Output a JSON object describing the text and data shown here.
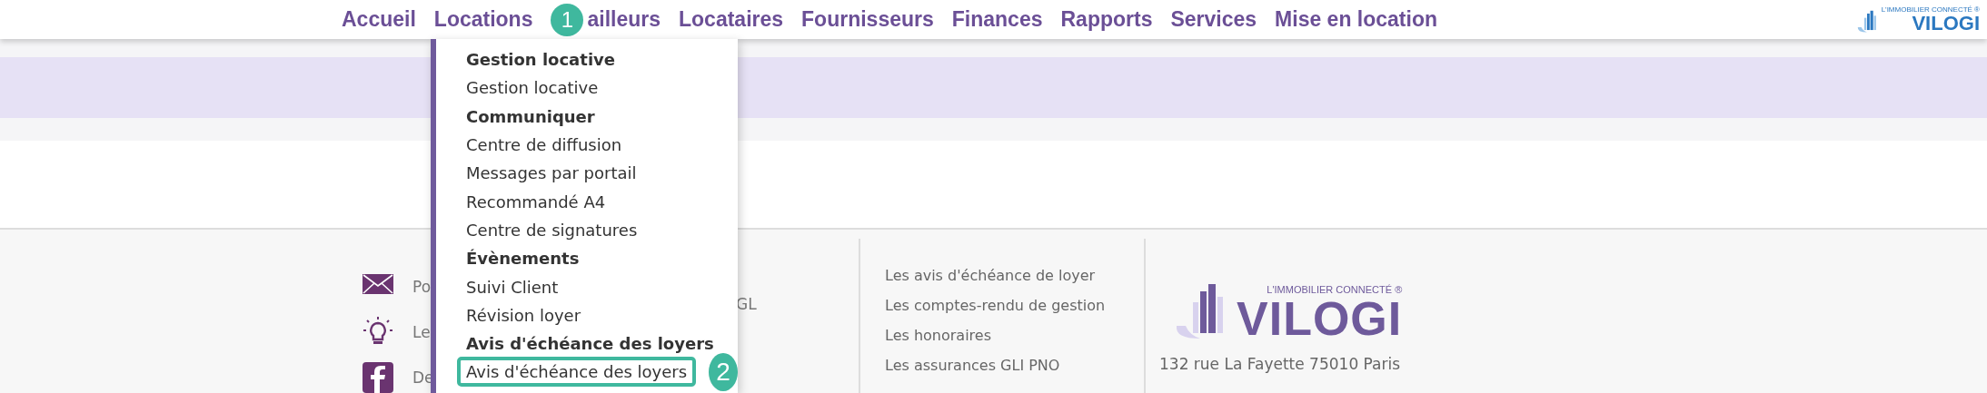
{
  "nav": {
    "items": [
      {
        "label": "Accueil"
      },
      {
        "label": "Locations"
      },
      {
        "label": "ailleurs",
        "callout": "1"
      },
      {
        "label": "Locataires"
      },
      {
        "label": "Fournisseurs"
      },
      {
        "label": "Finances"
      },
      {
        "label": "Rapports"
      },
      {
        "label": "Services"
      },
      {
        "label": "Mise en location"
      }
    ],
    "logo": {
      "tagline": "L'IMMOBILIER CONNECTÉ ®",
      "name": "VILOGI"
    }
  },
  "dropdown": {
    "items": [
      {
        "kind": "heading",
        "label": "Gestion locative"
      },
      {
        "kind": "link",
        "label": "Gestion locative",
        "highlighted": false
      },
      {
        "kind": "heading",
        "label": "Communiquer"
      },
      {
        "kind": "link",
        "label": "Centre de diffusion",
        "highlighted": false
      },
      {
        "kind": "link",
        "label": "Messages par portail",
        "highlighted": false
      },
      {
        "kind": "link",
        "label": "Recommandé A4",
        "highlighted": false
      },
      {
        "kind": "link",
        "label": "Centre de signatures",
        "highlighted": false
      },
      {
        "kind": "heading",
        "label": "Évènements"
      },
      {
        "kind": "link",
        "label": "Suivi Client",
        "highlighted": false
      },
      {
        "kind": "link",
        "label": "Révision loyer",
        "highlighted": false
      },
      {
        "kind": "heading",
        "label": "Avis d'échéance des loyers"
      },
      {
        "kind": "link",
        "label": "Avis d'échéance des loyers",
        "highlighted": true,
        "callout": "2"
      }
    ]
  },
  "footer": {
    "contact": [
      {
        "kind": "mail",
        "text": "Po"
      },
      {
        "kind": "bulb",
        "text": "Le"
      },
      {
        "kind": "facebook",
        "text": "De"
      }
    ],
    "column_2_fragment": "GL",
    "links": [
      "Les avis d'échéance de loyer",
      "Les comptes-rendu de gestion",
      "Les honoraires",
      "Les assurances GLI PNO"
    ],
    "brand": {
      "tagline": "L'IMMOBILIER CONNECTÉ ®",
      "name": "VILOGI"
    },
    "address": "132 rue La Fayette 75010 Paris"
  }
}
